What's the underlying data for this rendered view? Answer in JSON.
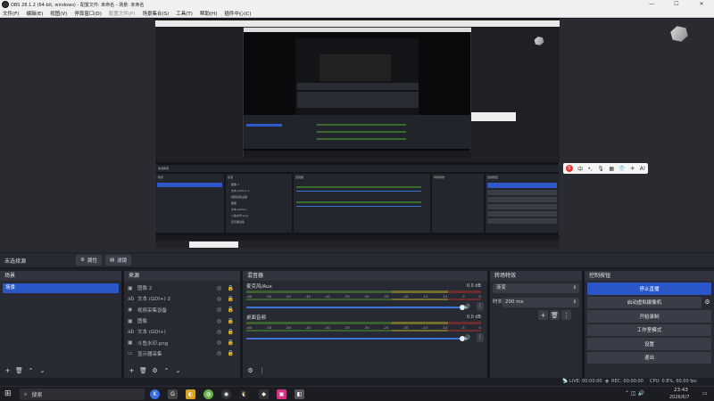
{
  "window": {
    "title": "OBS 28.1.2 (64-bit, windows) - 配置文件: 未命名 - 场景: 未命名",
    "controls": [
      "—",
      "☐",
      "✕"
    ]
  },
  "menu": [
    {
      "label": "文件(F)",
      "enabled": true
    },
    {
      "label": "编辑(E)",
      "enabled": true
    },
    {
      "label": "视图(V)",
      "enabled": true
    },
    {
      "label": "停靠窗口(D)",
      "enabled": true
    },
    {
      "label": "配置文件(P)",
      "enabled": false
    },
    {
      "label": "场景集合(S)",
      "enabled": true
    },
    {
      "label": "工具(T)",
      "enabled": true
    },
    {
      "label": "帮助(H)",
      "enabled": true
    },
    {
      "label": "插件中心(C)",
      "enabled": true
    }
  ],
  "ime_toolbar": {
    "items": [
      "S",
      "中",
      "•,",
      "🎙",
      "▦",
      "👕",
      "✈",
      "A!"
    ]
  },
  "source_toolbar": {
    "no_source": "未选择源",
    "properties": "属性",
    "filters": "滤镜"
  },
  "scenes": {
    "title": "场景",
    "items": [
      "场景"
    ]
  },
  "sources": {
    "title": "来源",
    "items": [
      {
        "icon": "image-icon",
        "label": "图像 2"
      },
      {
        "icon": "text-icon",
        "label": "文本 (GDI+) 2"
      },
      {
        "icon": "camera-icon",
        "label": "视频采集设备"
      },
      {
        "icon": "image-icon",
        "label": "图像"
      },
      {
        "icon": "text-icon",
        "label": "文本 (GDI+)"
      },
      {
        "icon": "image-icon",
        "label": "斗鱼水印.png"
      },
      {
        "icon": "monitor-icon",
        "label": "显示器采集"
      }
    ]
  },
  "mixer": {
    "title": "混音器",
    "tracks": [
      {
        "name": "麦克风/Aux",
        "db": "0.0 dB"
      },
      {
        "name": "桌面音频",
        "db": "0.0 dB"
      }
    ],
    "ticks": [
      "-60",
      "-55",
      "-50",
      "-45",
      "-40",
      "-35",
      "-30",
      "-25",
      "-20",
      "-15",
      "-10",
      "-5",
      "0"
    ]
  },
  "transitions": {
    "title": "转场特效",
    "type": "渐变",
    "duration_label": "时长",
    "duration_value": "200 ms"
  },
  "controls": {
    "title": "控制按钮",
    "buttons": [
      {
        "label": "停止直播",
        "active": true
      },
      {
        "label": "启动虚拟摄像机",
        "active": false
      },
      {
        "label": "开始录制",
        "active": false
      },
      {
        "label": "工作室模式",
        "active": false
      },
      {
        "label": "设置",
        "active": false
      },
      {
        "label": "退出",
        "active": false
      }
    ]
  },
  "status": {
    "live": "LIVE: 00:00:00",
    "rec": "REC: 00:00:00",
    "cpu": "CPU: 0.8%, 60.00 fps"
  },
  "taskbar": {
    "search": "搜索",
    "time": "23:43",
    "date": "2026/6/7"
  },
  "colors": {
    "accent": "#2b56c8",
    "panel": "#272a33",
    "background": "#1d1f26"
  }
}
